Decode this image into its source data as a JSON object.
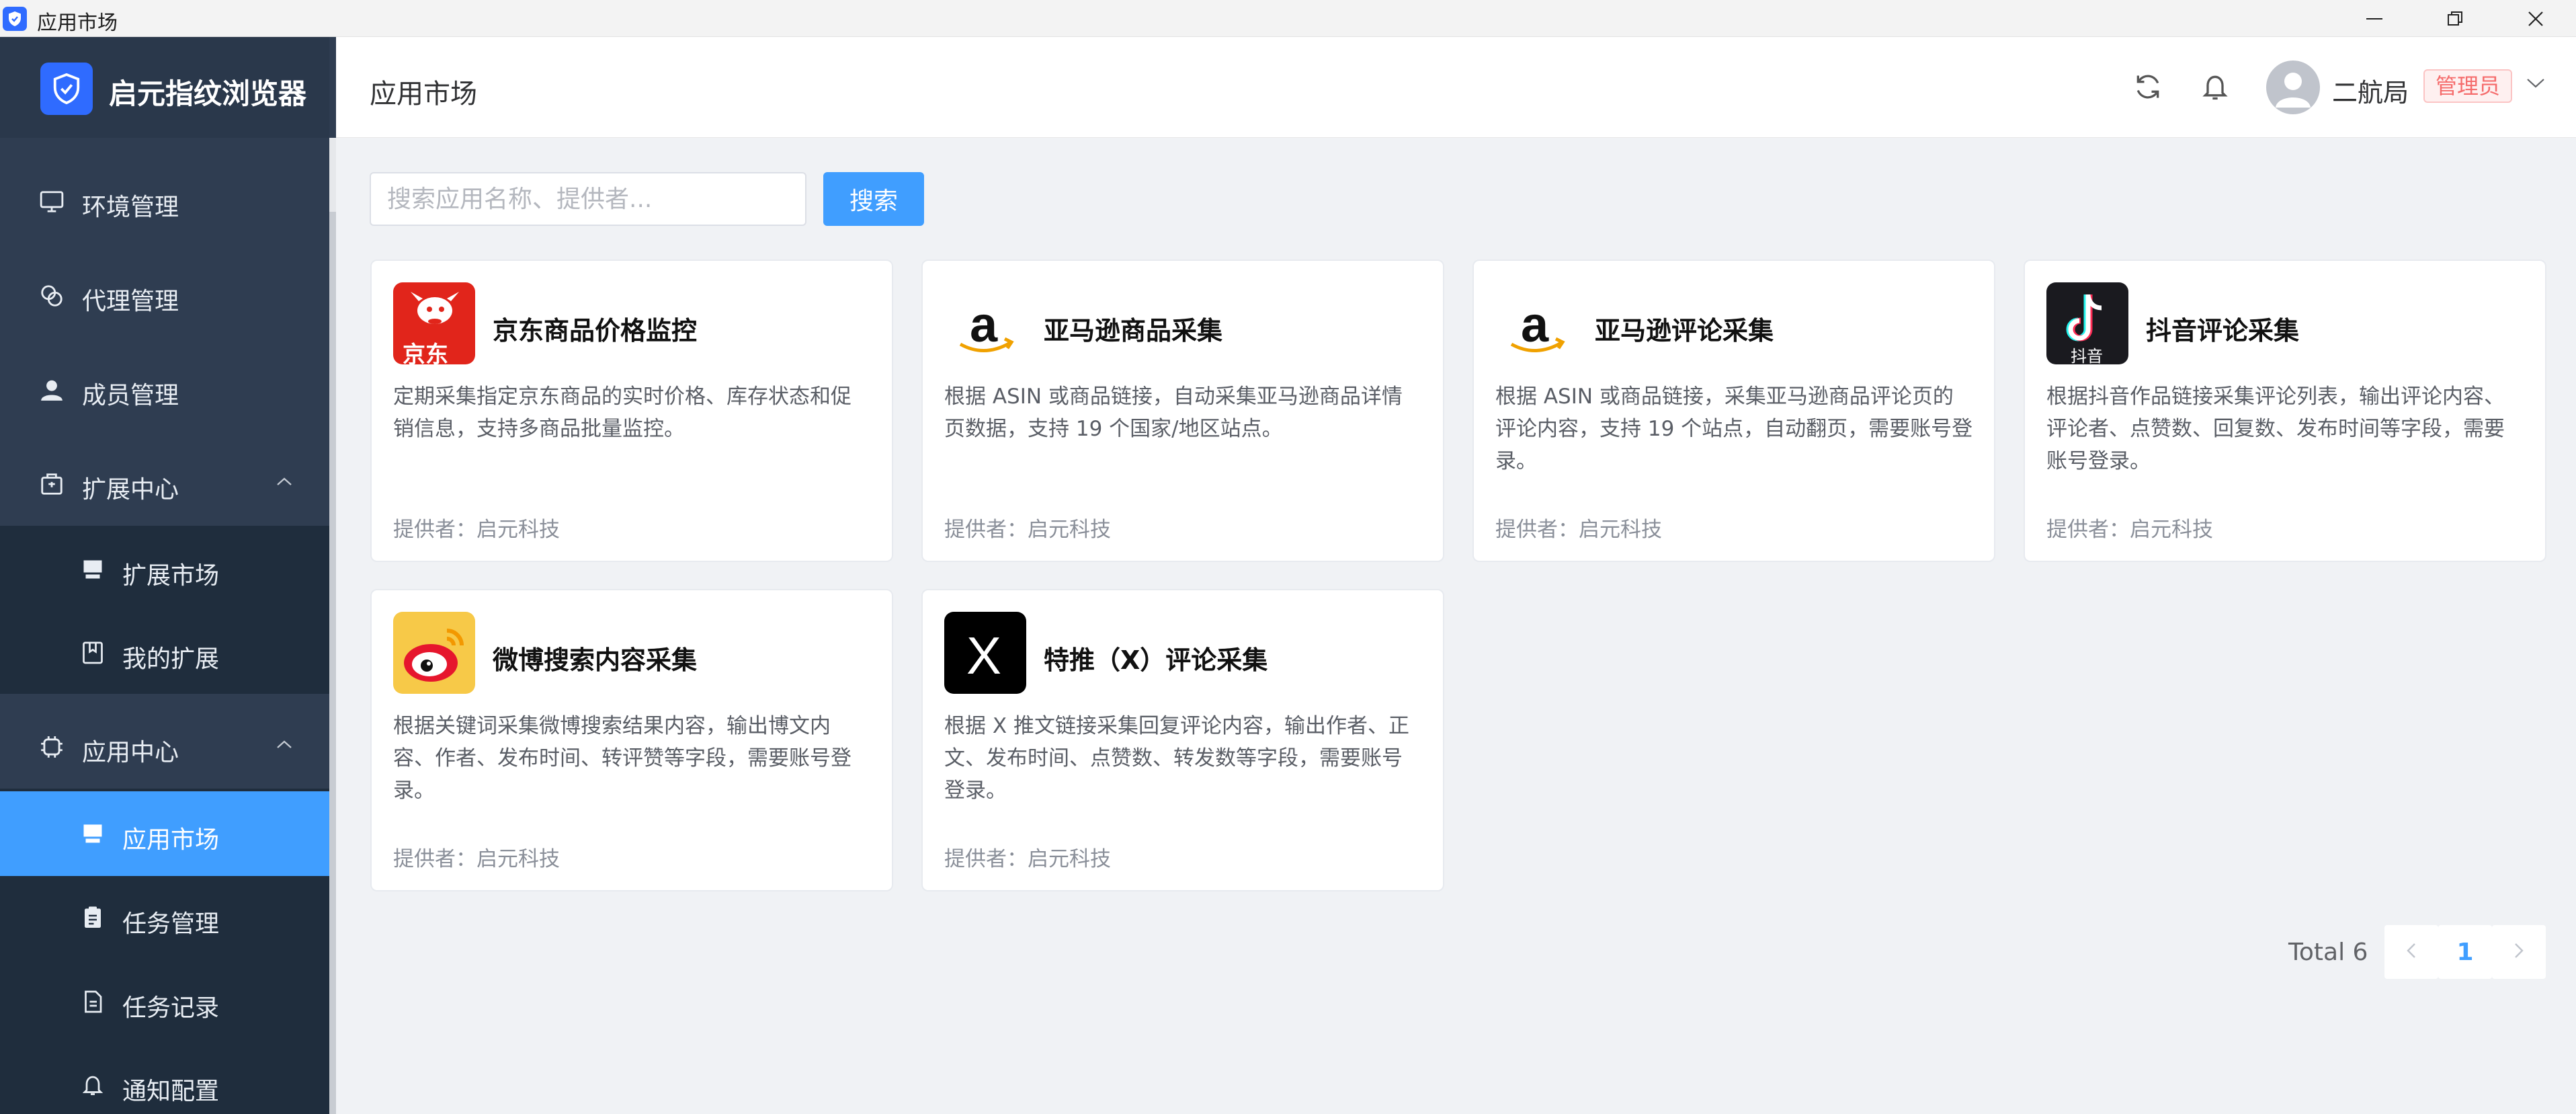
{
  "window": {
    "title": "应用市场"
  },
  "brand": {
    "name": "启元指纹浏览器"
  },
  "sidebar": {
    "items": [
      {
        "label": "环境管理",
        "icon": "monitor-icon"
      },
      {
        "label": "代理管理",
        "icon": "link-icon"
      },
      {
        "label": "成员管理",
        "icon": "user-icon"
      },
      {
        "label": "扩展中心",
        "icon": "package-icon",
        "expanded": true,
        "children": [
          {
            "label": "扩展市场",
            "icon": "store-icon"
          },
          {
            "label": "我的扩展",
            "icon": "bookmark-box-icon"
          }
        ]
      },
      {
        "label": "应用中心",
        "icon": "chip-icon",
        "expanded": true,
        "children": [
          {
            "label": "应用市场",
            "icon": "store-icon",
            "active": true
          },
          {
            "label": "任务管理",
            "icon": "clipboard-icon"
          },
          {
            "label": "任务记录",
            "icon": "document-icon"
          },
          {
            "label": "通知配置",
            "icon": "bell-icon"
          }
        ]
      }
    ]
  },
  "header": {
    "title": "应用市场",
    "username": "二航局",
    "role": "管理员"
  },
  "search": {
    "placeholder": "搜索应用名称、提供者...",
    "value": "",
    "button_label": "搜索"
  },
  "apps": [
    {
      "name": "京东商品价格监控",
      "logo_text": "京东",
      "desc": "定期采集指定京东商品的实时价格、库存状态和促销信息，支持多商品批量监控。",
      "provider": "提供者：启元科技"
    },
    {
      "name": "亚马逊商品采集",
      "logo_text": "a",
      "desc": "根据 ASIN 或商品链接，自动采集亚马逊商品详情页数据，支持 19 个国家/地区站点。",
      "provider": "提供者：启元科技"
    },
    {
      "name": "亚马逊评论采集",
      "logo_text": "a",
      "desc": "根据 ASIN 或商品链接，采集亚马逊商品评论页的评论内容，支持 19 个站点，自动翻页，需要账号登录。",
      "provider": "提供者：启元科技"
    },
    {
      "name": "抖音评论采集",
      "logo_text": "抖音",
      "desc": "根据抖音作品链接采集评论列表，输出评论内容、评论者、点赞数、回复数、发布时间等字段，需要账号登录。",
      "provider": "提供者：启元科技"
    },
    {
      "name": "微博搜索内容采集",
      "logo_text": "",
      "desc": "根据关键词采集微博搜索结果内容，输出博文内容、作者、发布时间、转评赞等字段，需要账号登录。",
      "provider": "提供者：启元科技"
    },
    {
      "name": "特推（X）评论采集",
      "logo_text": "X",
      "desc": "根据 X 推文链接采集回复评论内容，输出作者、正文、发布时间、点赞数、转发数等字段，需要账号登录。",
      "provider": "提供者：启元科技"
    }
  ],
  "pagination": {
    "total_label": "Total 6",
    "current_page": "1"
  },
  "colors": {
    "sidebar_bg": "#2f3d51",
    "submenu_bg": "#1f2d3d",
    "accent": "#409eff",
    "brand_blue": "#2f6bff",
    "admin_badge": "#f56c6c"
  }
}
